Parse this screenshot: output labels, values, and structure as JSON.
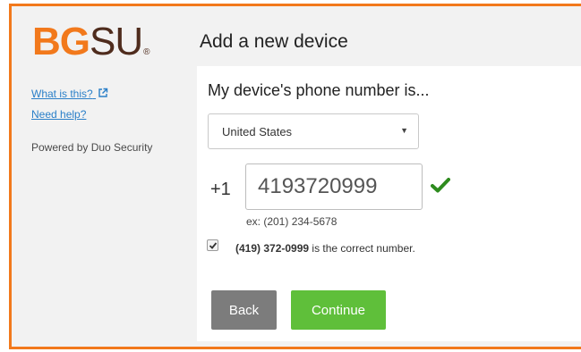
{
  "logo": {
    "bg": "BG",
    "su": "SU",
    "reg": "®",
    "colors": {
      "orange": "#f2791c",
      "brown": "#4f2c1d"
    }
  },
  "sidebar": {
    "what_is_this": "What is this?",
    "need_help": "Need help?",
    "powered_by": "Powered by Duo Security",
    "external_icon": "external-link-icon"
  },
  "page": {
    "title": "Add a new device"
  },
  "form": {
    "question": "My device's phone number is...",
    "country": {
      "selected": "United States"
    },
    "phone": {
      "prefix": "+1",
      "value": "4193720999"
    },
    "valid_icon": "check-icon",
    "example": "ex: (201) 234-5678",
    "confirm": {
      "checked": true,
      "number": "(419) 372-0999",
      "suffix": " is the correct number."
    }
  },
  "buttons": {
    "back": "Back",
    "continue": "Continue"
  },
  "colors": {
    "accent": "#f2791c",
    "link": "#2a7fc8",
    "continue_button": "#5fbf3a",
    "back_button": "#7c7c7c",
    "valid_check": "#2e8b1e"
  }
}
